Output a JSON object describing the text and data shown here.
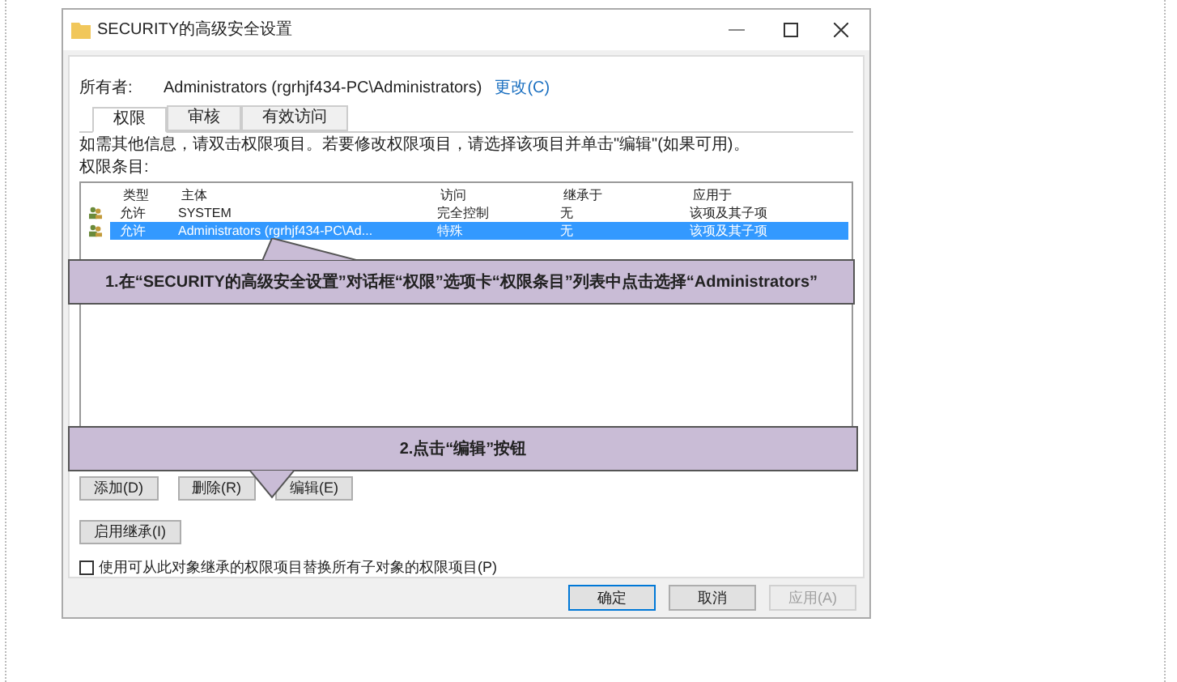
{
  "window": {
    "title": "SECURITY的高级安全设置"
  },
  "owner": {
    "label": "所有者:",
    "value": "Administrators (rgrhjf434-PC\\Administrators)",
    "link": "更改(C)"
  },
  "tabs": [
    {
      "label": "权限",
      "selected": true
    },
    {
      "label": "审核",
      "selected": false
    },
    {
      "label": "有效访问",
      "selected": false
    }
  ],
  "intro": "如需其他信息，请双击权限项目。若要修改权限项目，请选择该项目并单击\"编辑\"(如果可用)。",
  "list_label": "权限条目:",
  "table": {
    "columns": [
      "类型",
      "主体",
      "访问",
      "继承于",
      "应用于"
    ],
    "rows": [
      {
        "cells": [
          "允许",
          "SYSTEM",
          "完全控制",
          "无",
          "该项及其子项"
        ],
        "selected": false
      },
      {
        "cells": [
          "允许",
          "Administrators (rgrhjf434-PC\\Ad...",
          "特殊",
          "无",
          "该项及其子项"
        ],
        "selected": true
      }
    ]
  },
  "list_buttons": [
    "添加(D)",
    "删除(R)",
    "编辑(E)"
  ],
  "inherit_button": "启用继承(I)",
  "replace_option": {
    "label": "使用可从此对象继承的权限项目替换所有子对象的权限项目(P)",
    "checked": false
  },
  "dialog_buttons": [
    {
      "label": "确定",
      "disabled": false,
      "default": true
    },
    {
      "label": "取消",
      "disabled": false,
      "default": false
    },
    {
      "label": "应用(A)",
      "disabled": true,
      "default": false
    }
  ],
  "callouts": [
    {
      "text": "1.在“SECURITY的高级安全设置”对话框“权限”选项卡“权限条目”列表中点击选择“Administrators”",
      "kind": "up"
    },
    {
      "text": "2.点击“编辑”按钮",
      "kind": "down"
    }
  ]
}
